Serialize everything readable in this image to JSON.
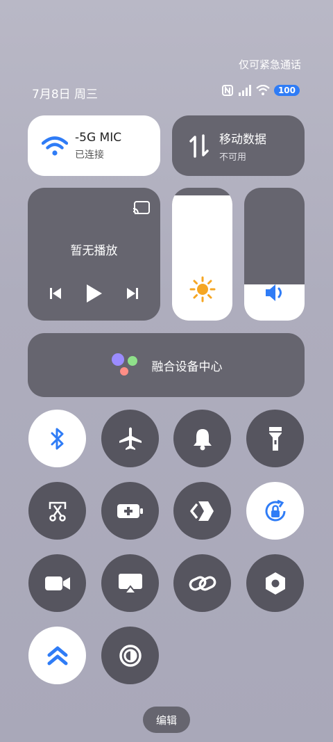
{
  "status": {
    "emergency_only": "仅可紧急通话",
    "date": "7月8日 周三",
    "battery": "100"
  },
  "wifi": {
    "name": "-5G     MIC",
    "state": "已连接"
  },
  "mobile_data": {
    "label": "移动数据",
    "state": "不可用"
  },
  "media": {
    "status": "暂无播放"
  },
  "brightness": {
    "level": 0.94
  },
  "volume": {
    "level": 0.27
  },
  "fusion_center": {
    "label": "融合设备中心"
  },
  "toggles": [
    {
      "name": "bluetooth",
      "on": true
    },
    {
      "name": "airplane",
      "on": false
    },
    {
      "name": "ring",
      "on": false
    },
    {
      "name": "flashlight",
      "on": false
    },
    {
      "name": "screenshot",
      "on": false
    },
    {
      "name": "battery-saver",
      "on": false
    },
    {
      "name": "app-share",
      "on": false
    },
    {
      "name": "rotation-lock",
      "on": true
    },
    {
      "name": "screen-record",
      "on": false
    },
    {
      "name": "screen-cast",
      "on": false
    },
    {
      "name": "link",
      "on": false
    },
    {
      "name": "nfc-settings",
      "on": false
    },
    {
      "name": "super-mode",
      "on": true
    },
    {
      "name": "dark-mode",
      "on": false
    }
  ],
  "colors": {
    "accent": "#2f7cf6",
    "tile_dark": "#66656f",
    "tile_light": "#ffffff",
    "brightness_icon": "#f5a623"
  },
  "edit": {
    "label": "编辑"
  }
}
